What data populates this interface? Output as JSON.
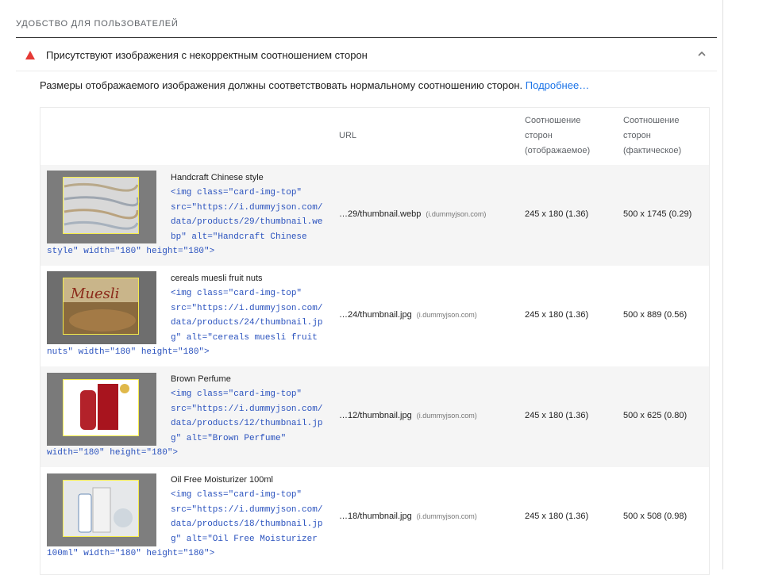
{
  "section": {
    "title": "УДОБСТВО ДЛЯ ПОЛЬЗОВАТЕЛЕЙ"
  },
  "audit": {
    "title": "Присутствуют изображения с некорректным соотношением сторон",
    "description": "Размеры отображаемого изображения должны соответствовать нормальному соотношению сторон.",
    "learn_more": "Подробнее…"
  },
  "colors": {
    "warning": "#e53935",
    "link": "#1a73e8",
    "code": "#2a52be"
  },
  "table": {
    "headers": {
      "url": "URL",
      "displayed": [
        "Соотношение",
        "сторон",
        "(отображаемое)"
      ],
      "actual": [
        "Соотношение",
        "сторон",
        "(фактическое)"
      ]
    },
    "rows": [
      {
        "name": "Handcraft Chinese style",
        "code_lines": [
          "<img class=\"card-img-top\"",
          "src=\"https://i.dummyjson.com/",
          "data/products/29/thumbnail.we",
          "bp\" alt=\"Handcraft Chinese",
          "style\" width=\"180\" height=\"180\">"
        ],
        "url": "…29/thumbnail.webp",
        "host": "(i.dummyjson.com)",
        "displayed": "245 x 180 (1.36)",
        "actual": "500 x 1745 (0.29)"
      },
      {
        "name": "cereals muesli fruit nuts",
        "code_lines": [
          "<img class=\"card-img-top\"",
          "src=\"https://i.dummyjson.com/",
          "data/products/24/thumbnail.jp",
          "g\" alt=\"cereals muesli fruit",
          "nuts\" width=\"180\" height=\"180\">"
        ],
        "url": "…24/thumbnail.jpg",
        "host": "(i.dummyjson.com)",
        "displayed": "245 x 180 (1.36)",
        "actual": "500 x 889 (0.56)"
      },
      {
        "name": "Brown Perfume",
        "code_lines": [
          "<img class=\"card-img-top\"",
          "src=\"https://i.dummyjson.com/",
          "data/products/12/thumbnail.jp",
          "g\" alt=\"Brown Perfume\"",
          "width=\"180\" height=\"180\">"
        ],
        "url": "…12/thumbnail.jpg",
        "host": "(i.dummyjson.com)",
        "displayed": "245 x 180 (1.36)",
        "actual": "500 x 625 (0.80)"
      },
      {
        "name": "Oil Free Moisturizer 100ml",
        "code_lines": [
          "<img class=\"card-img-top\"",
          "src=\"https://i.dummyjson.com/",
          "data/products/18/thumbnail.jp",
          "g\" alt=\"Oil Free Moisturizer",
          "100ml\" width=\"180\" height=\"180\">"
        ],
        "url": "…18/thumbnail.jpg",
        "host": "(i.dummyjson.com)",
        "displayed": "245 x 180 (1.36)",
        "actual": "500 x 508 (0.98)"
      }
    ]
  }
}
